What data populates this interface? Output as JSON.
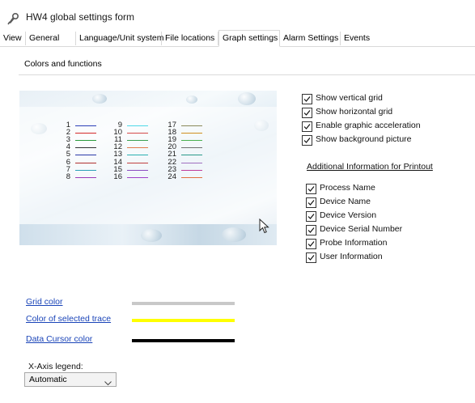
{
  "window": {
    "title": "HW4 global settings form"
  },
  "tabs": [
    {
      "label": "View",
      "active": false
    },
    {
      "label": "General",
      "active": false
    },
    {
      "label": "Language/Unit system",
      "active": false
    },
    {
      "label": "File locations",
      "active": false
    },
    {
      "label": "Graph settings",
      "active": true
    },
    {
      "label": "Alarm Settings",
      "active": false
    },
    {
      "label": "Events",
      "active": false
    }
  ],
  "section": {
    "title": "Colors and functions"
  },
  "traces": [
    {
      "number": "1",
      "color": "#2c3fb8"
    },
    {
      "number": "2",
      "color": "#d42a2a"
    },
    {
      "number": "3",
      "color": "#2a9a3c"
    },
    {
      "number": "4",
      "color": "#333333"
    },
    {
      "number": "5",
      "color": "#2a3aa8"
    },
    {
      "number": "6",
      "color": "#b03030"
    },
    {
      "number": "7",
      "color": "#2aa0b8"
    },
    {
      "number": "8",
      "color": "#9a3ab8"
    },
    {
      "number": "9",
      "color": "#4fd8e8"
    },
    {
      "number": "10",
      "color": "#d44a4a"
    },
    {
      "number": "11",
      "color": "#3aa050"
    },
    {
      "number": "12",
      "color": "#e07a4a"
    },
    {
      "number": "13",
      "color": "#2ab0b0"
    },
    {
      "number": "14",
      "color": "#c04040"
    },
    {
      "number": "15",
      "color": "#8a4ac0"
    },
    {
      "number": "16",
      "color": "#a040c8"
    },
    {
      "number": "17",
      "color": "#8a8a5a"
    },
    {
      "number": "18",
      "color": "#d09020"
    },
    {
      "number": "19",
      "color": "#4ab050"
    },
    {
      "number": "20",
      "color": "#707070"
    },
    {
      "number": "21",
      "color": "#2a9a8a"
    },
    {
      "number": "22",
      "color": "#a070c0"
    },
    {
      "number": "23",
      "color": "#c03a9a"
    },
    {
      "number": "24",
      "color": "#e07040"
    }
  ],
  "display_options": [
    {
      "label": "Show vertical grid",
      "checked": true
    },
    {
      "label": "Show horizontal grid",
      "checked": true
    },
    {
      "label": "Enable graphic acceleration",
      "checked": true
    },
    {
      "label": "Show background picture",
      "checked": true
    }
  ],
  "printout": {
    "title": "Additional Information for Printout",
    "options": [
      {
        "label": "Process Name",
        "checked": true
      },
      {
        "label": "Device Name",
        "checked": true
      },
      {
        "label": "Device Version",
        "checked": true
      },
      {
        "label": "Device Serial Number",
        "checked": true
      },
      {
        "label": "Probe Information",
        "checked": true
      },
      {
        "label": "User Information",
        "checked": true
      }
    ]
  },
  "colors": [
    {
      "label": "Grid color",
      "swatch": "#c8c8c8"
    },
    {
      "label": "Color of selected trace",
      "swatch": "#ffff00"
    },
    {
      "label": "Data Cursor color",
      "swatch": "#000000"
    }
  ],
  "xaxis": {
    "label": "X-Axis legend:",
    "selected": "Automatic"
  }
}
